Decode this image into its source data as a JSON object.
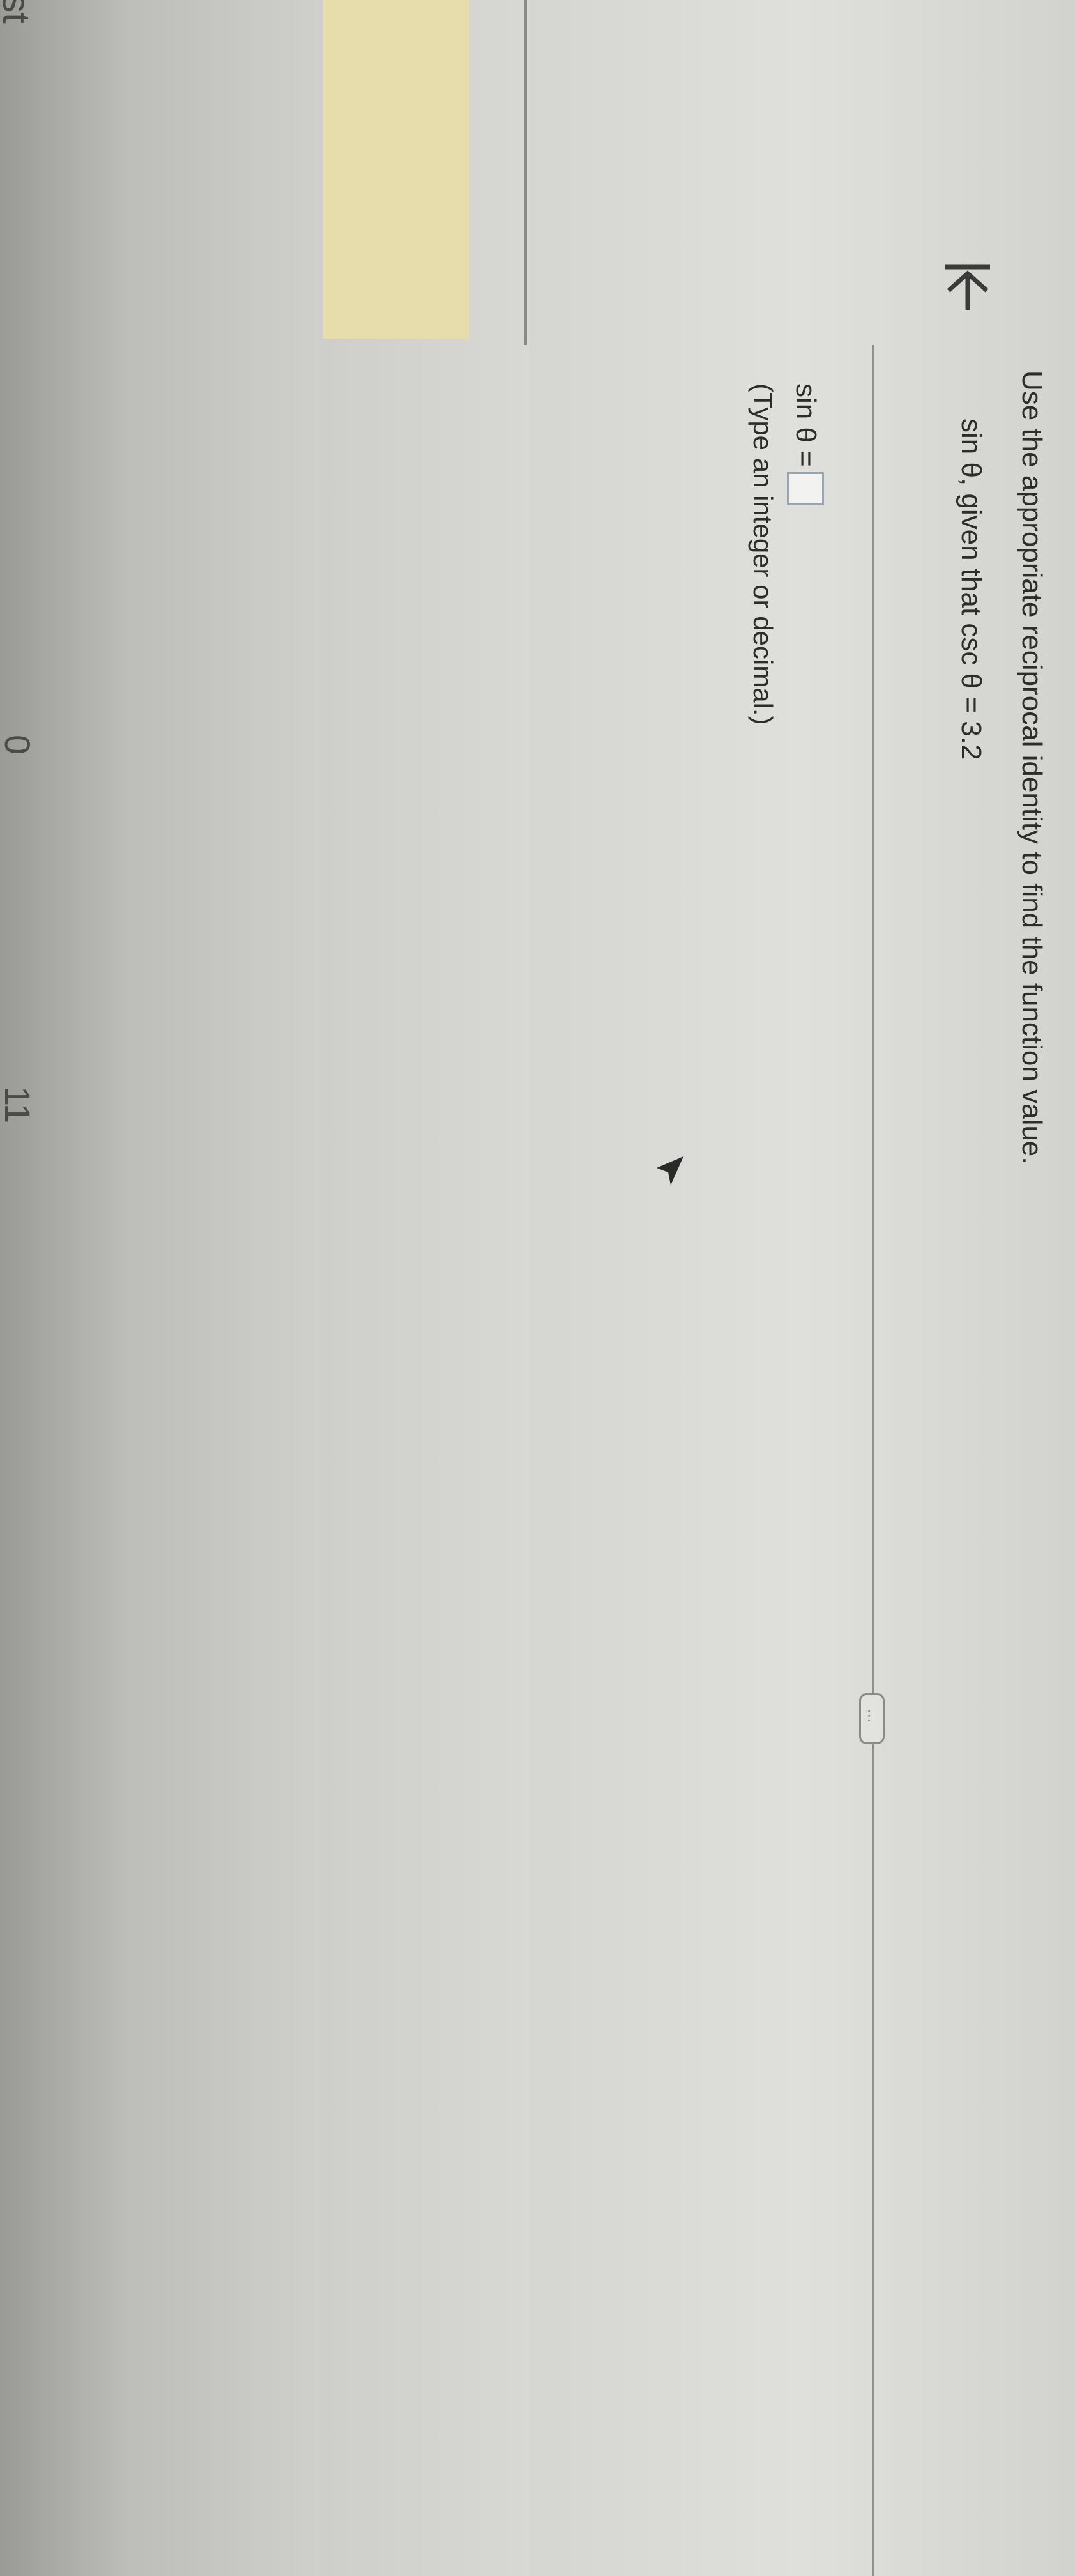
{
  "left_nav": {
    "label_top": "st",
    "label_mid": "0",
    "label_bottom": "11"
  },
  "question": {
    "instruction": "Use the appropriate reciprocal identity to find the function value.",
    "given": "sin θ, given that csc θ = 3.2",
    "answer_prefix": "sin θ =",
    "answer_value": "",
    "hint": "(Type an integer or decimal.)"
  },
  "toolbar": {
    "back_icon": "back-arrow-icon",
    "more_label": "..."
  },
  "colors": {
    "highlight": "#e7dcab",
    "input_border": "#9aa3b0"
  }
}
